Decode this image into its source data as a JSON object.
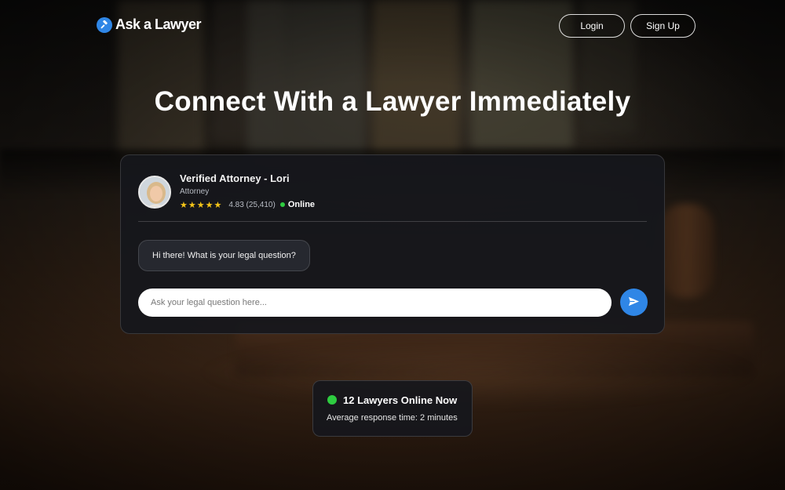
{
  "brand": {
    "name": "Ask a Lawyer",
    "icon": "gavel-icon",
    "accent_color": "#2f86e6"
  },
  "nav": {
    "login_label": "Login",
    "signup_label": "Sign Up"
  },
  "hero": {
    "title": "Connect With a Lawyer Immediately"
  },
  "chat": {
    "agent_name": "Verified Attorney - Lori",
    "agent_role": "Attorney",
    "stars": "★★★★★",
    "rating": "4.83 (25,410)",
    "status": "Online",
    "status_color": "#2ecc40",
    "greeting": "Hi there! What is your legal question?",
    "input_placeholder": "Ask your legal question here...",
    "send_icon": "send-icon"
  },
  "availability": {
    "title": "12 Lawyers Online Now",
    "subtitle": "Average response time: 2 minutes"
  }
}
